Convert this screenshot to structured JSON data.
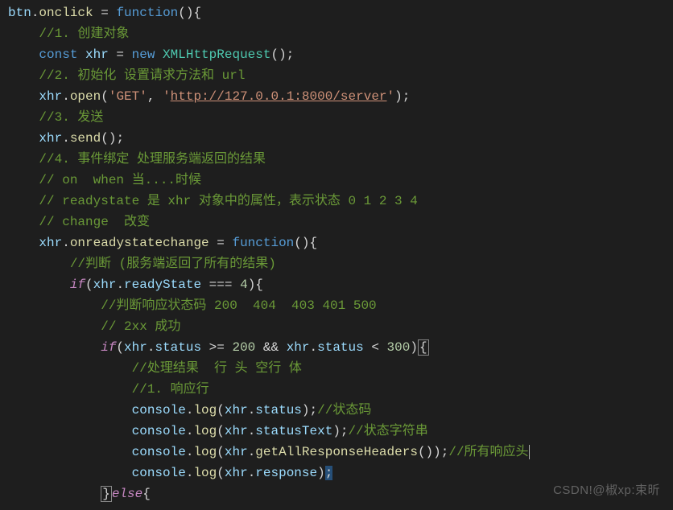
{
  "code": {
    "lines": [
      {
        "indent": 0,
        "tokens": [
          {
            "t": "btn",
            "c": "var"
          },
          {
            "t": ".",
            "c": "punct"
          },
          {
            "t": "onclick",
            "c": "func"
          },
          {
            "t": " = ",
            "c": "op"
          },
          {
            "t": "function",
            "c": "kw"
          },
          {
            "t": "(){",
            "c": "punct"
          }
        ]
      },
      {
        "indent": 1,
        "tokens": [
          {
            "t": "//1. 创建对象",
            "c": "comment"
          }
        ]
      },
      {
        "indent": 1,
        "tokens": [
          {
            "t": "const ",
            "c": "kw"
          },
          {
            "t": "xhr",
            "c": "var"
          },
          {
            "t": " = ",
            "c": "op"
          },
          {
            "t": "new ",
            "c": "kw"
          },
          {
            "t": "XMLHttpRequest",
            "c": "type"
          },
          {
            "t": "();",
            "c": "punct"
          }
        ]
      },
      {
        "indent": 1,
        "tokens": [
          {
            "t": "//2. 初始化 设置请求方法和 ",
            "c": "comment"
          },
          {
            "t": "url",
            "c": "comment"
          }
        ]
      },
      {
        "indent": 1,
        "tokens": [
          {
            "t": "xhr",
            "c": "var"
          },
          {
            "t": ".",
            "c": "punct"
          },
          {
            "t": "open",
            "c": "func"
          },
          {
            "t": "(",
            "c": "punct"
          },
          {
            "t": "'GET'",
            "c": "str"
          },
          {
            "t": ", ",
            "c": "punct"
          },
          {
            "t": "'",
            "c": "str"
          },
          {
            "t": "http://127.0.0.1:8000/server",
            "c": "str url"
          },
          {
            "t": "'",
            "c": "str"
          },
          {
            "t": ");",
            "c": "punct"
          }
        ]
      },
      {
        "indent": 1,
        "tokens": [
          {
            "t": "//3. 发送",
            "c": "comment"
          }
        ]
      },
      {
        "indent": 1,
        "tokens": [
          {
            "t": "xhr",
            "c": "var"
          },
          {
            "t": ".",
            "c": "punct"
          },
          {
            "t": "send",
            "c": "func"
          },
          {
            "t": "();",
            "c": "punct"
          }
        ]
      },
      {
        "indent": 1,
        "tokens": [
          {
            "t": "//4. 事件绑定 处理服务端返回的结果",
            "c": "comment"
          }
        ]
      },
      {
        "indent": 1,
        "tokens": [
          {
            "t": "// on  when 当....时候",
            "c": "comment"
          }
        ]
      },
      {
        "indent": 1,
        "tokens": [
          {
            "t": "// readystate 是 xhr 对象中的属性，表示状态 0 1 2 3 4",
            "c": "comment"
          }
        ]
      },
      {
        "indent": 1,
        "tokens": [
          {
            "t": "// change  改变",
            "c": "comment"
          }
        ]
      },
      {
        "indent": 1,
        "tokens": [
          {
            "t": "xhr",
            "c": "var"
          },
          {
            "t": ".",
            "c": "punct"
          },
          {
            "t": "onreadystatechange",
            "c": "func"
          },
          {
            "t": " = ",
            "c": "op"
          },
          {
            "t": "function",
            "c": "kw"
          },
          {
            "t": "(){",
            "c": "punct"
          }
        ]
      },
      {
        "indent": 2,
        "tokens": [
          {
            "t": "//判断 (服务端返回了所有的结果)",
            "c": "comment"
          }
        ]
      },
      {
        "indent": 2,
        "tokens": [
          {
            "t": "if",
            "c": "ifkw"
          },
          {
            "t": "(",
            "c": "punct"
          },
          {
            "t": "xhr",
            "c": "var"
          },
          {
            "t": ".",
            "c": "punct"
          },
          {
            "t": "readyState",
            "c": "prop"
          },
          {
            "t": " === ",
            "c": "op"
          },
          {
            "t": "4",
            "c": "num"
          },
          {
            "t": "){",
            "c": "punct"
          }
        ]
      },
      {
        "indent": 3,
        "tokens": [
          {
            "t": "//判断响应状态码 200  404  403 401 500",
            "c": "comment"
          }
        ]
      },
      {
        "indent": 3,
        "tokens": [
          {
            "t": "// 2xx 成功",
            "c": "comment"
          }
        ]
      },
      {
        "indent": 3,
        "tokens": [
          {
            "t": "if",
            "c": "ifkw"
          },
          {
            "t": "(",
            "c": "punct"
          },
          {
            "t": "xhr",
            "c": "var"
          },
          {
            "t": ".",
            "c": "punct"
          },
          {
            "t": "status",
            "c": "prop"
          },
          {
            "t": " >= ",
            "c": "op"
          },
          {
            "t": "200",
            "c": "num"
          },
          {
            "t": " && ",
            "c": "op"
          },
          {
            "t": "xhr",
            "c": "var"
          },
          {
            "t": ".",
            "c": "punct"
          },
          {
            "t": "status",
            "c": "prop"
          },
          {
            "t": " < ",
            "c": "op"
          },
          {
            "t": "300",
            "c": "num"
          },
          {
            "t": ")",
            "c": "punct"
          },
          {
            "t": "{",
            "c": "punct bracket-box"
          }
        ]
      },
      {
        "indent": 4,
        "tokens": [
          {
            "t": "//处理结果  行 头 空行 体",
            "c": "comment"
          }
        ]
      },
      {
        "indent": 4,
        "tokens": [
          {
            "t": "//1. 响应行",
            "c": "comment"
          }
        ]
      },
      {
        "indent": 4,
        "tokens": [
          {
            "t": "console",
            "c": "var"
          },
          {
            "t": ".",
            "c": "punct"
          },
          {
            "t": "log",
            "c": "func"
          },
          {
            "t": "(",
            "c": "punct"
          },
          {
            "t": "xhr",
            "c": "var"
          },
          {
            "t": ".",
            "c": "punct"
          },
          {
            "t": "status",
            "c": "prop"
          },
          {
            "t": ");",
            "c": "punct"
          },
          {
            "t": "//状态码",
            "c": "comment"
          }
        ]
      },
      {
        "indent": 4,
        "tokens": [
          {
            "t": "console",
            "c": "var"
          },
          {
            "t": ".",
            "c": "punct"
          },
          {
            "t": "log",
            "c": "func"
          },
          {
            "t": "(",
            "c": "punct"
          },
          {
            "t": "xhr",
            "c": "var"
          },
          {
            "t": ".",
            "c": "punct"
          },
          {
            "t": "statusText",
            "c": "prop"
          },
          {
            "t": ");",
            "c": "punct"
          },
          {
            "t": "//状态字符串",
            "c": "comment"
          }
        ]
      },
      {
        "indent": 4,
        "tokens": [
          {
            "t": "console",
            "c": "var"
          },
          {
            "t": ".",
            "c": "punct"
          },
          {
            "t": "log",
            "c": "func"
          },
          {
            "t": "(",
            "c": "punct"
          },
          {
            "t": "xhr",
            "c": "var"
          },
          {
            "t": ".",
            "c": "punct"
          },
          {
            "t": "getAllResponseHeaders",
            "c": "func"
          },
          {
            "t": "());",
            "c": "punct"
          },
          {
            "t": "//所有响应头",
            "c": "comment"
          }
        ],
        "cursorAfter": true
      },
      {
        "indent": 4,
        "tokens": [
          {
            "t": "console",
            "c": "var"
          },
          {
            "t": ".",
            "c": "punct"
          },
          {
            "t": "log",
            "c": "func"
          },
          {
            "t": "(",
            "c": "punct"
          },
          {
            "t": "xhr",
            "c": "var"
          },
          {
            "t": ".",
            "c": "punct"
          },
          {
            "t": "response",
            "c": "prop"
          },
          {
            "t": ")",
            "c": "punct"
          },
          {
            "t": ";",
            "c": "punct highlight"
          }
        ]
      },
      {
        "indent": 3,
        "tokens": [
          {
            "t": "}",
            "c": "punct bracket-box"
          },
          {
            "t": "else",
            "c": "ifkw"
          },
          {
            "t": "{",
            "c": "punct"
          }
        ]
      }
    ]
  },
  "watermark": "CSDN!@椒xp:束昕"
}
